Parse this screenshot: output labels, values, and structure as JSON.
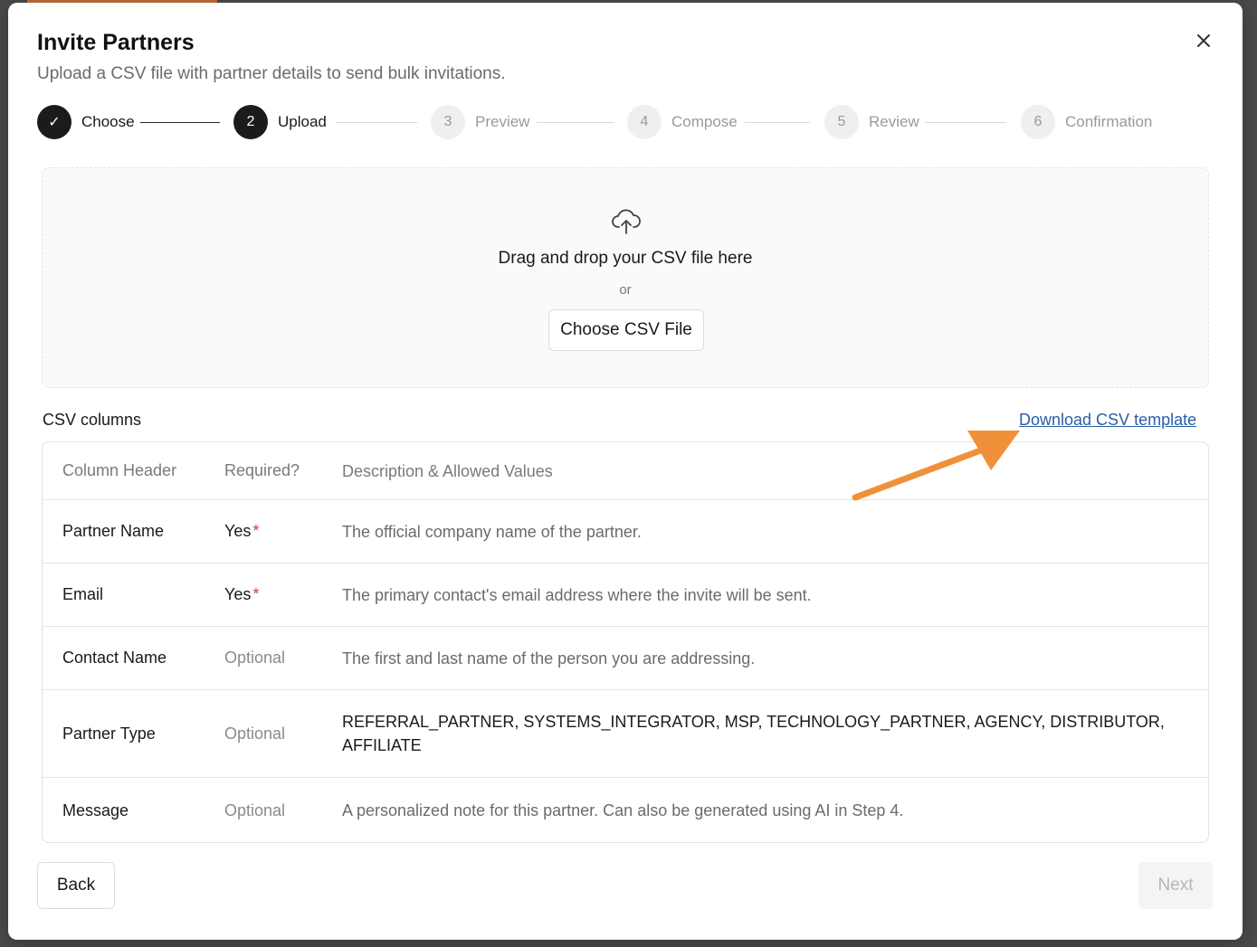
{
  "modal": {
    "title": "Invite Partners",
    "subtitle": "Upload a CSV file with partner details to send bulk invitations.",
    "close_icon": "close-icon"
  },
  "stepper": {
    "steps": [
      {
        "number": "✓",
        "label": "Choose",
        "state": "done"
      },
      {
        "number": "2",
        "label": "Upload",
        "state": "active"
      },
      {
        "number": "3",
        "label": "Preview",
        "state": "pending"
      },
      {
        "number": "4",
        "label": "Compose",
        "state": "pending"
      },
      {
        "number": "5",
        "label": "Review",
        "state": "pending"
      },
      {
        "number": "6",
        "label": "Confirmation",
        "state": "pending"
      }
    ]
  },
  "dropzone": {
    "icon": "cloud-upload-icon",
    "title": "Drag and drop your CSV file here",
    "or_text": "or",
    "button_label": "Choose CSV File"
  },
  "csv_columns": {
    "label": "CSV columns",
    "download_link": "Download CSV template",
    "headers": [
      "Column Header",
      "Required?",
      "Description & Allowed Values"
    ],
    "rows": [
      {
        "column": "Partner Name",
        "required": "Yes",
        "required_mark": "*",
        "description": "The official company name of the partner."
      },
      {
        "column": "Email",
        "required": "Yes",
        "required_mark": "*",
        "description": "The primary contact's email address where the invite will be sent."
      },
      {
        "column": "Contact Name",
        "required": "Optional",
        "required_mark": "",
        "description": "The first and last name of the person you are addressing."
      },
      {
        "column": "Partner Type",
        "required": "Optional",
        "required_mark": "",
        "description": "REFERRAL_PARTNER, SYSTEMS_INTEGRATOR, MSP, TECHNOLOGY_PARTNER, AGENCY, DISTRIBUTOR, AFFILIATE"
      },
      {
        "column": "Message",
        "required": "Optional",
        "required_mark": "",
        "description": "A personalized note for this partner. Can also be generated using AI in Step 4."
      }
    ]
  },
  "footer": {
    "back_label": "Back",
    "next_label": "Next"
  },
  "annotation": {
    "icon": "orange-arrow-icon",
    "color": "#f0913a"
  },
  "colors": {
    "primary": "#1b1b1b",
    "link": "#2a5fa8",
    "required_star": "#d63b3b"
  }
}
